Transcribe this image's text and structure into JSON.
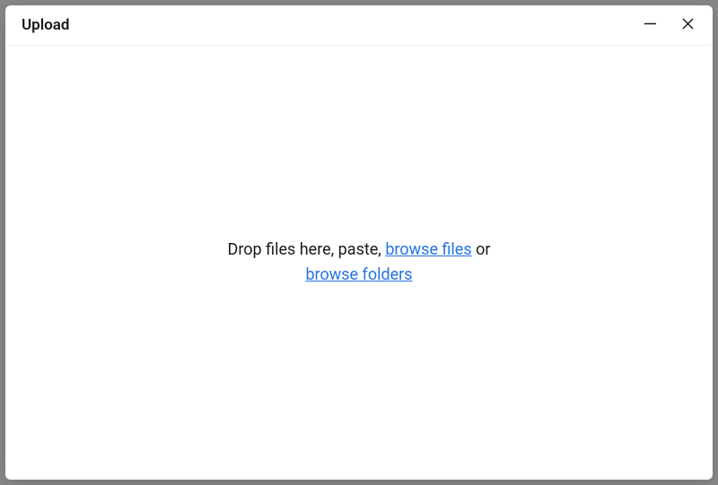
{
  "modal": {
    "title": "Upload",
    "drop_text_prefix": "Drop files here, paste, ",
    "browse_files": "browse files",
    "drop_text_middle": " or ",
    "browse_folders": "browse folders"
  }
}
